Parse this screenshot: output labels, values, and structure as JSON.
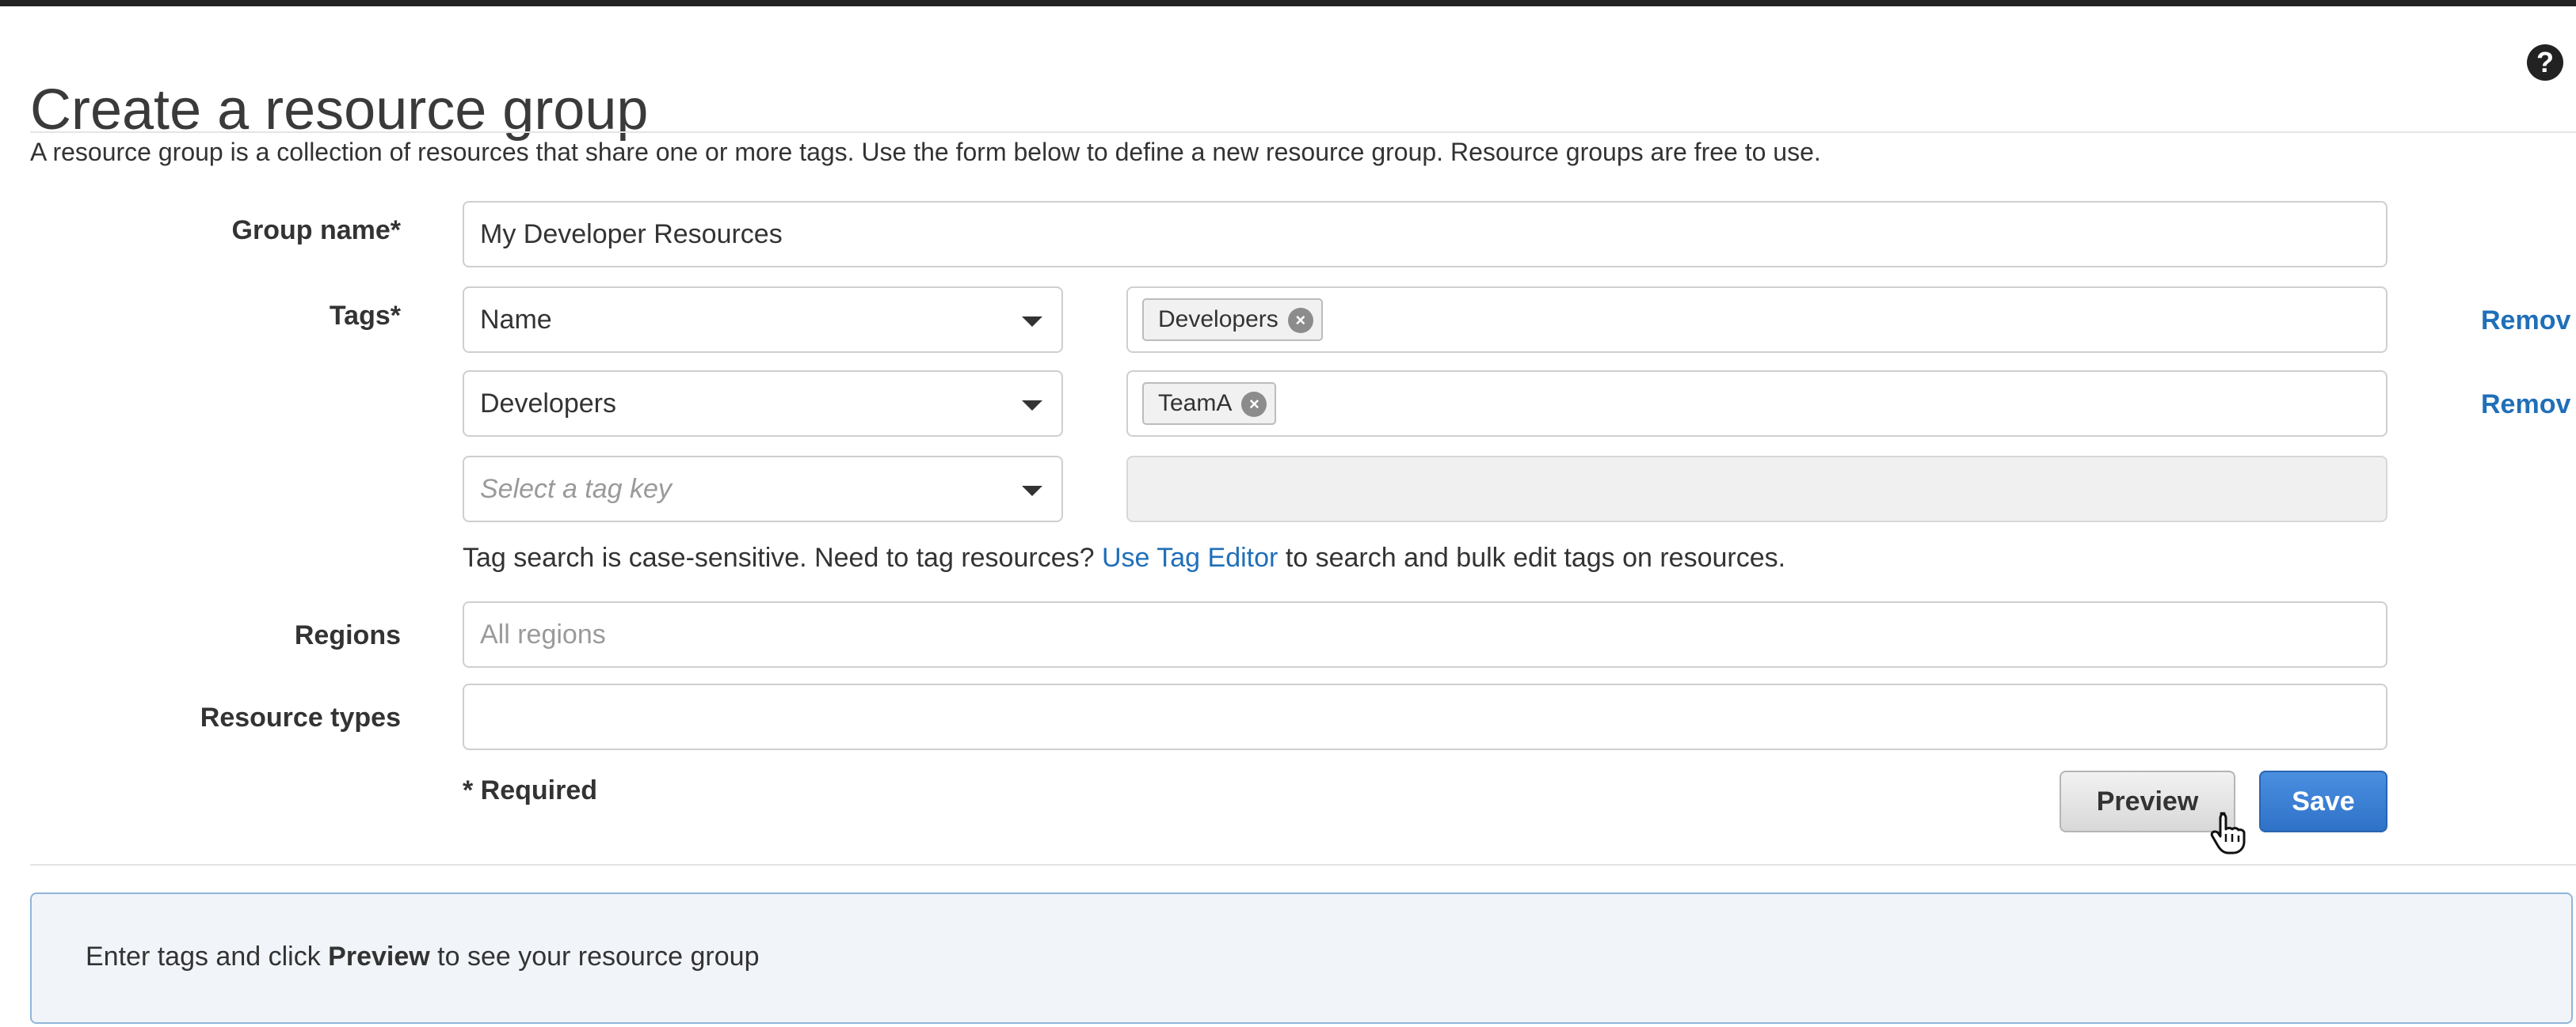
{
  "page": {
    "title": "Create a resource group",
    "description": "A resource group is a collection of resources that share one or more tags. Use the form below to define a new resource group. Resource groups are free to use.",
    "help_icon": "question-circle-icon"
  },
  "form": {
    "group_name": {
      "label": "Group name*",
      "value": "My Developer Resources"
    },
    "tags": {
      "label": "Tags*",
      "rows": [
        {
          "key": "Name",
          "values": [
            "Developers"
          ],
          "remove_label": "Remov"
        },
        {
          "key": "Developers",
          "values": [
            "TeamA"
          ],
          "remove_label": "Remov"
        }
      ],
      "new_key_placeholder": "Select a tag key"
    },
    "hint": {
      "before": "Tag search is case-sensitive. Need to tag resources?",
      "link": "Use Tag Editor",
      "after": "to search and bulk edit tags on resources."
    },
    "regions": {
      "label": "Regions",
      "placeholder": "All regions"
    },
    "resource_types": {
      "label": "Resource types",
      "value": ""
    },
    "required_note": "* Required",
    "buttons": {
      "preview": "Preview",
      "save": "Save"
    }
  },
  "info_box": {
    "before": "Enter tags and click",
    "bold": "Preview",
    "after": "to see your resource group"
  },
  "colors": {
    "link": "#1f6fb8",
    "save_button": "#3579d0",
    "info_border": "#8fb5d9"
  }
}
